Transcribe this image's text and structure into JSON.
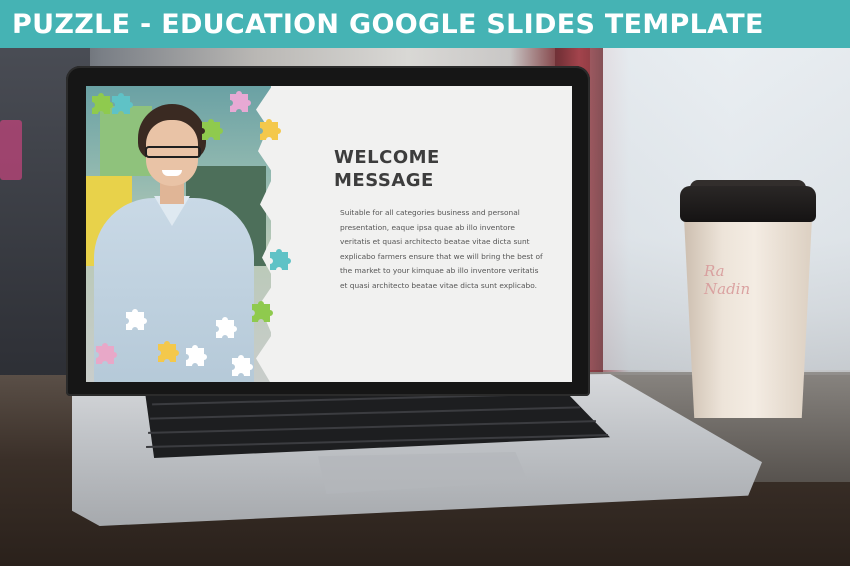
{
  "banner": {
    "title": "PUZZLE - EDUCATION GOOGLE SLIDES TEMPLATE",
    "color": "#45b3b4"
  },
  "slide": {
    "heading_line1": "WELCOME",
    "heading_line2": "MESSAGE",
    "body_lines": [
      "Suitable for all categories business and personal",
      "presentation, eaque ipsa quae ab illo inventore",
      "veritatis et quasi architecto  beatae vitae dicta sunt",
      "explicabo farmers ensure that we will bring the best of",
      "the market to your kimquae ab illo inventore veritatis",
      "et quasi architecto beatae vitae dicta sunt explicabo."
    ],
    "puzzle_colors": [
      "#e7a9d4",
      "#5fc2c6",
      "#8fca4e",
      "#f4c84b",
      "#e8a8c8"
    ]
  },
  "cup": {
    "writing_line1": "Ra",
    "writing_line2": "Nadin"
  },
  "icons": [
    "puzzle-piece-icon"
  ]
}
